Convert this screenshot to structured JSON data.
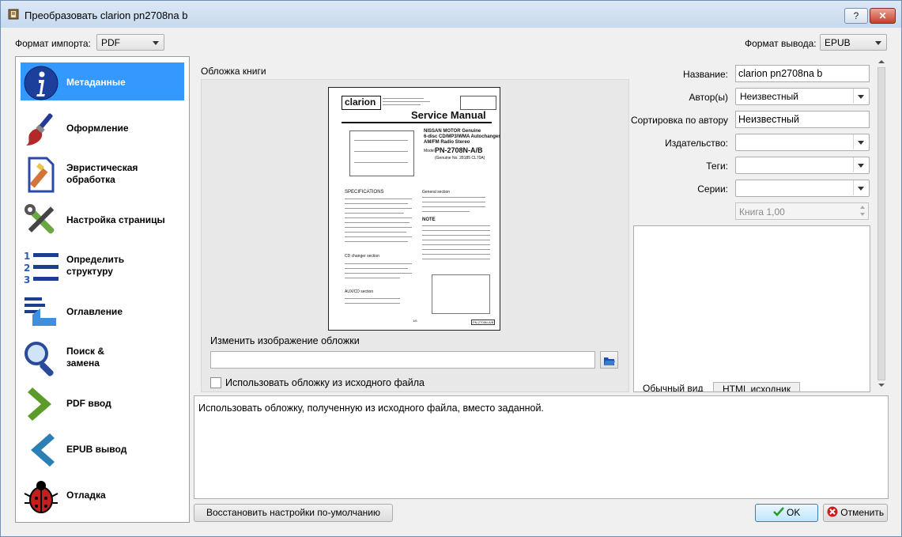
{
  "window": {
    "title": "Преобразовать clarion pn2708na b",
    "help_button": "?",
    "close_button": "✕"
  },
  "import_format": {
    "label": "Формат импорта:",
    "value": "PDF"
  },
  "output_format": {
    "label": "Формат вывода:",
    "value": "EPUB"
  },
  "sidebar": {
    "items": [
      {
        "label": "Метаданные",
        "icon": "info-icon"
      },
      {
        "label": "Оформление",
        "icon": "paintbrush-icon"
      },
      {
        "label": "Эвристическая обработка",
        "line1": "Эвристическая",
        "line2": "обработка",
        "icon": "document-wand-icon"
      },
      {
        "label": "Настройка страницы",
        "icon": "tools-icon"
      },
      {
        "label": "Определить структуру",
        "line1": "Определить",
        "line2": "структуру",
        "icon": "numbered-list-icon"
      },
      {
        "label": "Оглавление",
        "icon": "toc-hand-icon"
      },
      {
        "label": "Поиск & замена",
        "line1": "Поиск &",
        "line2": "замена",
        "icon": "magnifier-icon"
      },
      {
        "label": "PDF ввод",
        "icon": "chevron-right-icon"
      },
      {
        "label": "EPUB вывод",
        "icon": "chevron-left-icon"
      },
      {
        "label": "Отладка",
        "icon": "bug-icon"
      }
    ]
  },
  "cover": {
    "section_label": "Обложка книги",
    "change_label": "Изменить изображение обложки",
    "path_value": "",
    "use_source_cover_label": "Использовать обложку из исходного файла",
    "use_source_cover_checked": false,
    "preview": {
      "brand": "clarion",
      "heading": "Service Manual",
      "product_line1": "NISSAN MOTOR  Genuine",
      "product_line2": "6-disc CD/MP3/WMA Autochanger",
      "product_line3": "AM/FM Radio Stereo",
      "model_prefix": "Model",
      "model": "PN-2708N-A/B",
      "genuine_no": "(Genuine No. 28185 CL70A)",
      "specs_title": "SPECIFICATIONS",
      "general_title": "General section",
      "note_title": "NOTE",
      "cd_section": "CD changer section",
      "aux_section": "AUX/CD section",
      "footer_code": "PN-2708N-A/B",
      "page_num": "1/6"
    }
  },
  "metadata": {
    "title_label": "Название:",
    "title_value": "clarion pn2708na b",
    "author_label": "Автор(ы)",
    "author_value": "Неизвестный",
    "author_sort_label": "Сортировка по автору",
    "author_sort_value": "Неизвестный",
    "publisher_label": "Издательство:",
    "publisher_value": "",
    "tags_label": "Теги:",
    "tags_value": "",
    "series_label": "Серии:",
    "series_value": "",
    "series_index": "Книга 1,00",
    "comment_tabs": [
      "Обычный вид",
      "HTML исходник"
    ]
  },
  "help_text": "Использовать обложку, полученную из исходного файла, вместо заданной.",
  "buttons": {
    "restore_defaults": "Восстановить настройки по-умолчанию",
    "ok": "OK",
    "cancel": "Отменить"
  }
}
